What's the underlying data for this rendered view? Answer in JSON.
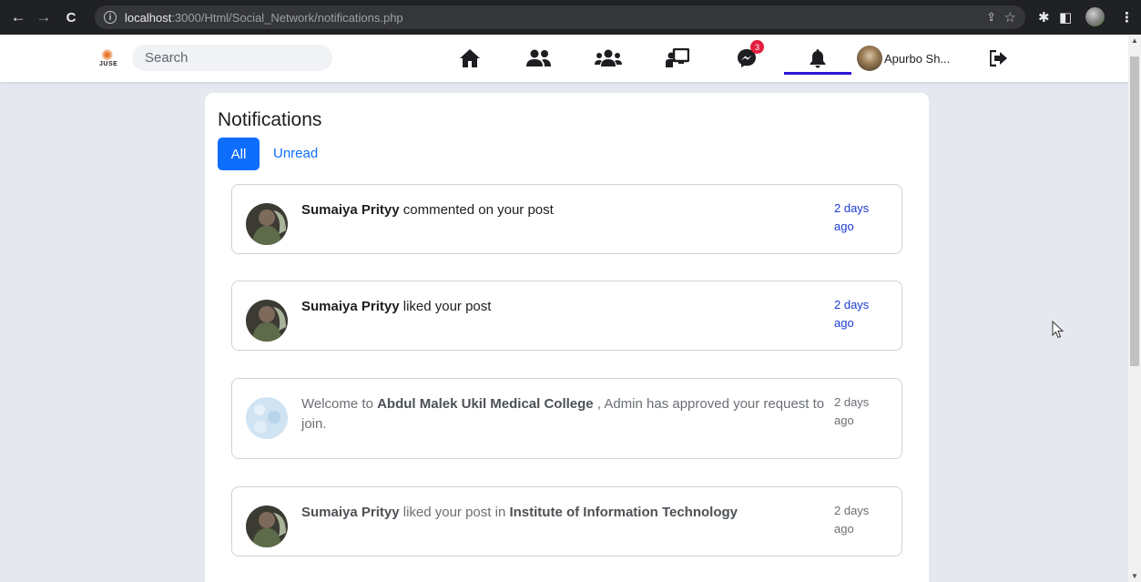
{
  "browser": {
    "url_host": "localhost",
    "url_rest": ":3000/Html/Social_Network/notifications.php"
  },
  "navbar": {
    "logo_text": "JUSE",
    "search_placeholder": "Search",
    "icons": [
      "home-icon",
      "friends-icon",
      "groups-icon",
      "pages-icon",
      "messenger-icon",
      "bell-icon"
    ],
    "messenger_badge": "3",
    "active": "bell-icon",
    "user_name": "Apurbo Sh...",
    "logout_icon": "logout-icon"
  },
  "page": {
    "title": "Notifications",
    "tabs": [
      {
        "label": "All",
        "active": true
      },
      {
        "label": "Unread",
        "active": false
      }
    ]
  },
  "notifications": [
    {
      "name": "Sumaiya Prityy",
      "text": " commented on your post",
      "time_line1": "2 days",
      "time_line2": "ago",
      "unread": true
    },
    {
      "name": "Sumaiya Prityy",
      "text": " liked your post",
      "time_line1": "2 days",
      "time_line2": "ago",
      "unread": true
    },
    {
      "prefix": "Welcome to ",
      "name": "Abdul Malek Ukil Medical College",
      "text_line1": " , Admin has approved your request to",
      "text_line2": "join.",
      "time_line1": "2 days",
      "time_line2": "ago",
      "unread": false
    },
    {
      "name": "Sumaiya Prityy",
      "text": " liked your post in ",
      "target": "Institute of Information Technology",
      "time_line1": "2 days",
      "time_line2": "ago",
      "unread": false
    }
  ],
  "colors": {
    "accent": "#0d6efd",
    "unread_time": "#1b3bd6",
    "badge": "#e41e3f",
    "page_bg": "#e6e8f0"
  }
}
